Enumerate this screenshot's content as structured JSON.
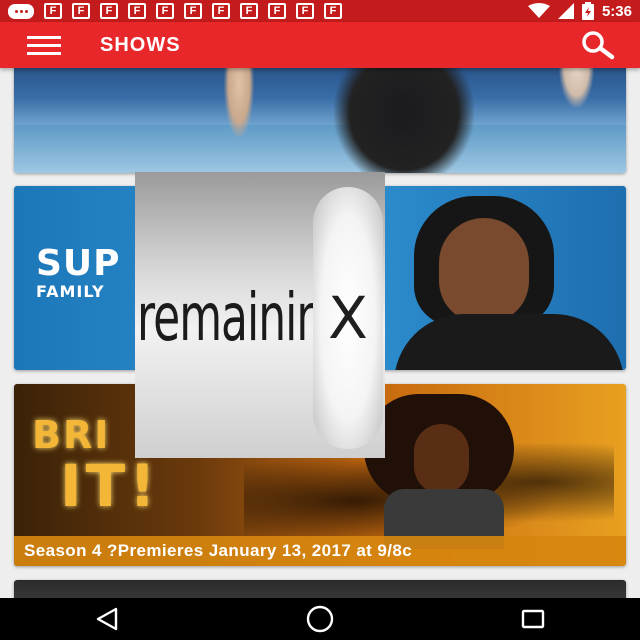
{
  "status_bar": {
    "time": "5:36",
    "notification_icons": [
      "message-icon",
      "flipboard-icon",
      "flipboard-icon",
      "flipboard-icon",
      "flipboard-icon",
      "flipboard-icon",
      "flipboard-icon",
      "flipboard-icon",
      "flipboard-icon",
      "flipboard-icon",
      "flipboard-icon",
      "flipboard-icon"
    ],
    "notification_glyph": "F"
  },
  "app_bar": {
    "title": "SHOWS",
    "color": "#e8272b"
  },
  "shows": [
    {
      "id": "card-1",
      "caption": ""
    },
    {
      "id": "card-2",
      "logo_line1": "SUP",
      "logo_line2": "FAMILY"
    },
    {
      "id": "card-3",
      "title_line1": "BRI",
      "title_line2": "IT!",
      "caption": "Season 4 ?Premieres January 13, 2017 at 9/8c"
    },
    {
      "id": "card-4",
      "caption": ""
    }
  ],
  "ad": {
    "text": "remaining",
    "close_label": "X"
  },
  "nav_bar": {
    "buttons": [
      "back-icon",
      "home-icon",
      "recents-icon"
    ]
  }
}
